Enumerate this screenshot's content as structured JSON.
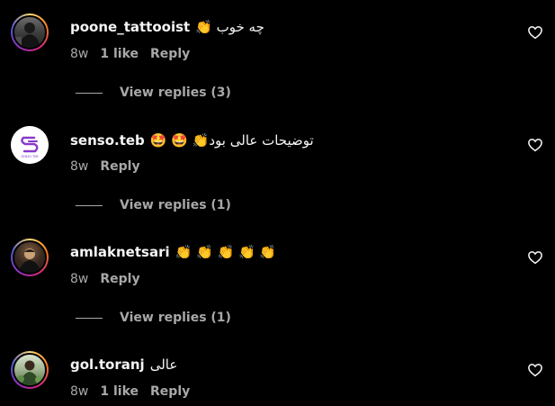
{
  "comments": [
    {
      "username": "poone_tattooist",
      "text": "👏 چه خوب",
      "time": "8w",
      "likes": "1 like",
      "reply_label": "Reply",
      "view_replies": "View replies (3)"
    },
    {
      "username": "senso.teb",
      "text": "🤩 🤩 👏توضیحات عالی بود",
      "time": "8w",
      "reply_label": "Reply",
      "view_replies": "View replies (1)",
      "avatar_caption": "SENSO TEB"
    },
    {
      "username": "amlaknetsari",
      "text": "👏 👏 👏 👏 👏",
      "time": "8w",
      "reply_label": "Reply",
      "view_replies": "View replies (1)"
    },
    {
      "username": "gol.toranj",
      "text": "عالی",
      "time": "8w",
      "likes": "1 like",
      "reply_label": "Reply"
    }
  ],
  "colors": {
    "background": "#000000",
    "text_primary": "#f5f5f5",
    "text_secondary": "#a8a8a8",
    "logo_purple": "#8a3ac9"
  },
  "icons": {
    "heart": "heart-outline-icon"
  }
}
